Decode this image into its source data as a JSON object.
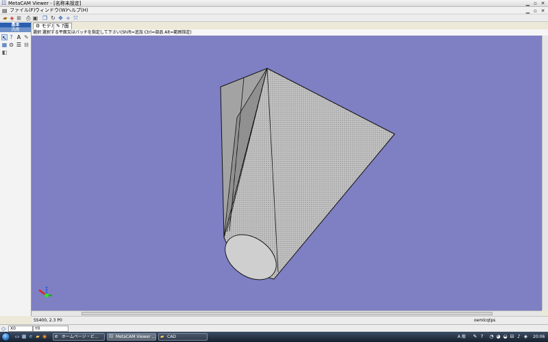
{
  "window": {
    "title": "MetaCAM Viewer - [名称未設定]"
  },
  "menu": {
    "items": [
      "ファイル(F)",
      "ウィンドウ(W)",
      "ヘルプ(H)"
    ]
  },
  "left_panel": {
    "header": "基本",
    "subheader": "汎用"
  },
  "tabs": [
    {
      "label": "モデル"
    },
    {
      "label": "ｱ面"
    }
  ],
  "hint": "選択 選択する平面又はパッチを指定して下さい(Shift=追加 Ctrl=部品 Alt=範囲指定)",
  "status": {
    "material": "SS400, 2.3 P0",
    "right_text": "oemlcqtps"
  },
  "coords": {
    "x": "X0",
    "y": "Y0"
  },
  "taskbar": {
    "tasks": [
      {
        "label": "ホームページ・ビ..."
      },
      {
        "label": "MetaCAM Viewer ..."
      },
      {
        "label": "CAD"
      }
    ],
    "tray": {
      "lang": "A 般",
      "time": "20:06"
    }
  },
  "colors": {
    "viewport_bg": "#7f7fc3",
    "model_fill": "#c9c9c9",
    "model_edge": "#111111"
  }
}
